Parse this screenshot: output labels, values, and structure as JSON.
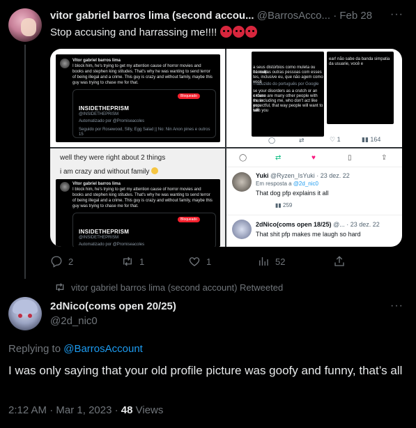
{
  "tweet1": {
    "author_name": "vitor gabriel barros lima (second accou...",
    "author_handle": "@BarrosAcco...",
    "separator": "·",
    "date": "Feb 28",
    "text": "Stop accusing and harrassing me!!!!",
    "emoji": [
      "angry-face",
      "angry-face",
      "angry-face"
    ],
    "media": {
      "card_author": "Vitor gabriel barros lima",
      "card_handle": "@BarrosAccount",
      "card_text_1": "I block him, he's trying to get my attention cause of horror movies and",
      "card_text_2": "books and stephen king stitudes. That's why he was wanting to send terror",
      "card_text_3": "of being illegal and a crime. This guy is crazy and without family, maybe this",
      "card_text_4": "guy was trying to chase me for that.",
      "profile_title": "INSIDETHEPRISM",
      "profile_handle": "@INSIDETHEPRISM",
      "auto_label": "Automatizado por @Promiseacoles",
      "follows_label": "Seguido por Rosewood, Silly, Egg Salad || No: Nin Anon pines e outros 15",
      "blocked_badge": "Bloqueado",
      "q3_line1": "well they were right about 2 things",
      "q3_line2": "i am crazy and without family",
      "q2_text_1": "ear! não sabe da banda simpatia da usuarie, você e",
      "q2_text_2": "a seus distúrbios como muleta ou desculp",
      "q2_text_3": "há muitas outras pessoas com esses",
      "q2_text_4": "tes, inclusive eu, que não agem como você",
      "q2_text_5": "se your disorders as a crutch or an excuse",
      "q2_text_6": "e there are many other people with these",
      "q2_text_7": "es, including me, who don't act like you.",
      "q2_text_8": "espectful, that way people will want to talk",
      "q2_text_9": "with you",
      "q2_translated": "Traduzido do português por Google",
      "q2_reply_count": "",
      "q2_likes": "1",
      "q2_views": "164",
      "q4_reply1_name": "Yuki",
      "q4_reply1_handle": "@Ryzen_IsYuki",
      "q4_reply1_date": "23 dez. 22",
      "q4_reply1_replying": "Em resposta a",
      "q4_reply1_replying_to": "@2d_nic0",
      "q4_reply1_text": "That dog pfp explains it all",
      "q4_reply1_views": "259",
      "q4_reply2_name": "2dNico(coms open 18/25)",
      "q4_reply2_handle": "@...",
      "q4_reply2_date": "23 dez. 22",
      "q4_reply2_text": "That shit pfp makes me laugh so hard"
    },
    "actions": {
      "replies": "2",
      "retweets": "1",
      "likes": "1",
      "views": "52"
    }
  },
  "retweeted_by": "vitor gabriel barros lima (second account) Retweeted",
  "tweet2": {
    "author_name": "2dNico(coms open 20/25)",
    "author_handle": "@2d_nic0",
    "replying_prefix": "Replying to",
    "replying_to": "@BarrosAccount",
    "text": "I was only saying that your old profile picture was goofy and funny, that’s all",
    "time": "2:12 AM",
    "date": "Mar 1, 2023",
    "views_count": "48",
    "views_label": "Views"
  },
  "colors": {
    "background": "#000000",
    "text": "#e7e9ea",
    "muted": "#71767b",
    "accent": "#1d9bf0",
    "blocked": "#f4212e",
    "like_pink": "#f91880",
    "divider": "#333639"
  },
  "icons": [
    "more-icon",
    "reply-icon",
    "retweet-icon",
    "like-icon",
    "views-icon",
    "share-icon",
    "bookmark-icon"
  ]
}
